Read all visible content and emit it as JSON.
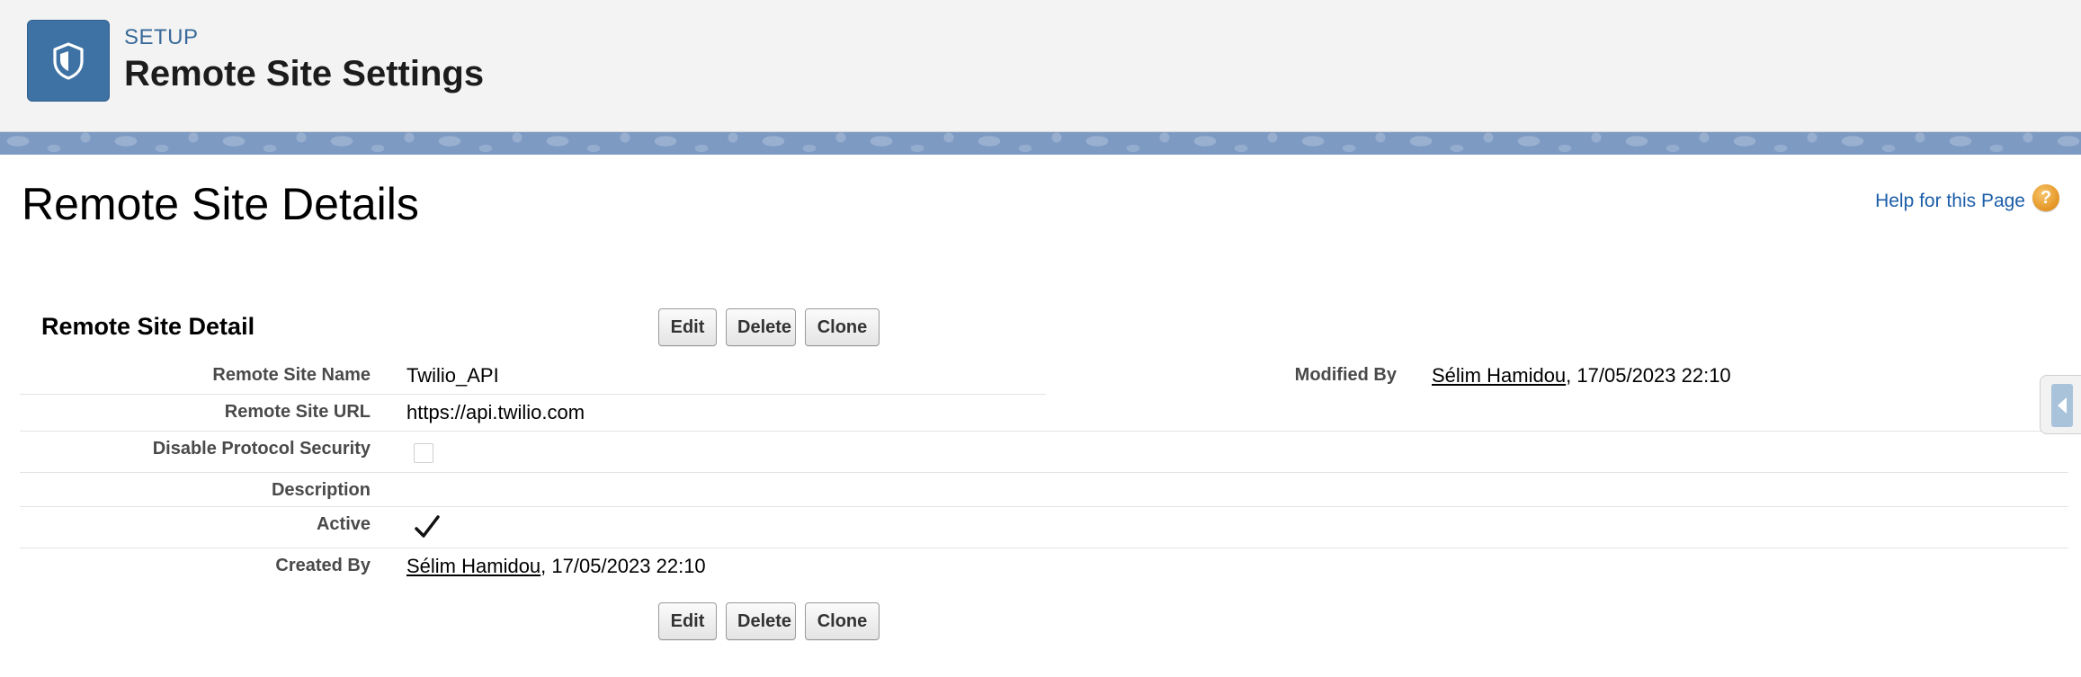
{
  "header": {
    "eyebrow": "SETUP",
    "title": "Remote Site Settings",
    "icon": "shield-icon"
  },
  "page": {
    "heading": "Remote Site Details",
    "help_label": "Help for this Page",
    "help_icon_glyph": "?"
  },
  "detail": {
    "section_title": "Remote Site Detail",
    "buttons": {
      "edit": "Edit",
      "delete": "Delete",
      "clone": "Clone"
    },
    "fields": {
      "remote_site_name": {
        "label": "Remote Site Name",
        "value": "Twilio_API"
      },
      "remote_site_url": {
        "label": "Remote Site URL",
        "value": "https://api.twilio.com"
      },
      "disable_protocol_security": {
        "label": "Disable Protocol Security",
        "checked": false
      },
      "description": {
        "label": "Description",
        "value": ""
      },
      "active": {
        "label": "Active",
        "checked": true
      },
      "created_by": {
        "label": "Created By",
        "user": "Sélim Hamidou",
        "timestamp": ", 17/05/2023 22:10"
      },
      "modified_by": {
        "label": "Modified By",
        "user": "Sélim Hamidou",
        "timestamp": ", 17/05/2023 22:10"
      }
    }
  },
  "colors": {
    "brand": "#3e72a5",
    "link": "#1b5da8",
    "banner": "#7d9ac3",
    "help_icon": "#e49524"
  }
}
